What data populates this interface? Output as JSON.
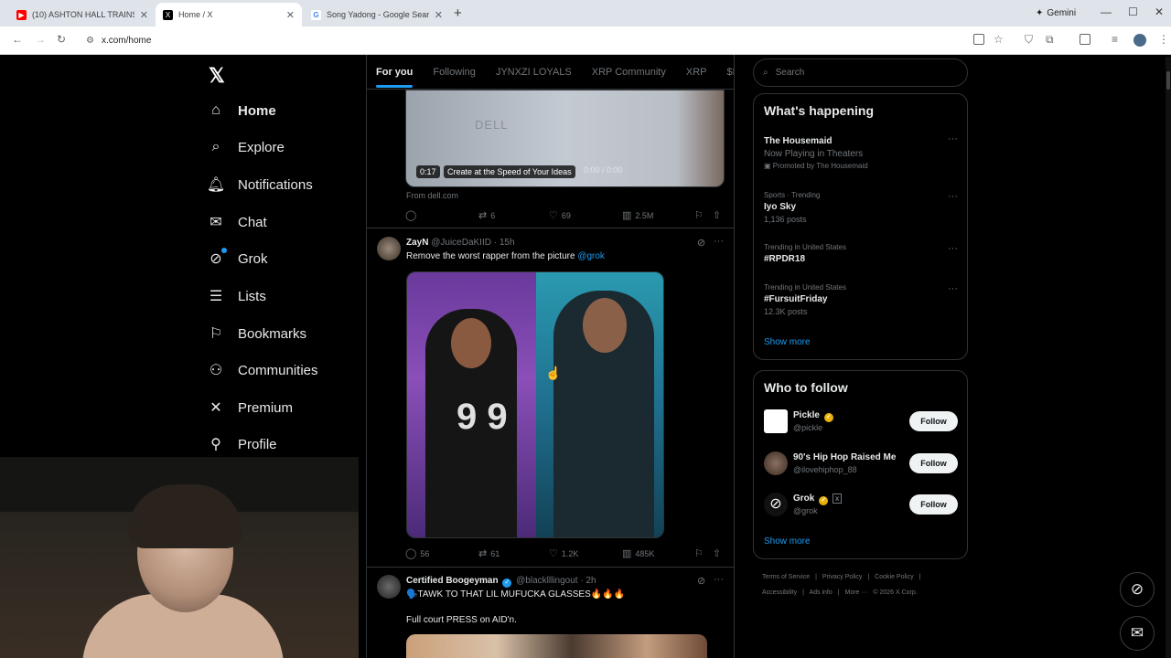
{
  "browser": {
    "tabs": [
      {
        "title": "(10) ASHTON HALL TRAINS AT",
        "favicon": "youtube-icon"
      },
      {
        "title": "Home / X",
        "favicon": "x-icon"
      },
      {
        "title": "Song Yadong - Google Search",
        "favicon": "google-icon"
      }
    ],
    "new_tab": "+",
    "gemini_label": "Gemini",
    "url": "x.com/home"
  },
  "nav": {
    "logo": "𝕏",
    "items": [
      {
        "label": "Home",
        "icon": "home-icon"
      },
      {
        "label": "Explore",
        "icon": "search-icon"
      },
      {
        "label": "Notifications",
        "icon": "bell-icon"
      },
      {
        "label": "Chat",
        "icon": "mail-icon"
      },
      {
        "label": "Grok",
        "icon": "grok-icon"
      },
      {
        "label": "Lists",
        "icon": "list-icon"
      },
      {
        "label": "Bookmarks",
        "icon": "bookmark-icon"
      },
      {
        "label": "Communities",
        "icon": "people-icon"
      },
      {
        "label": "Premium",
        "icon": "x-icon"
      },
      {
        "label": "Profile",
        "icon": "person-icon"
      }
    ]
  },
  "feed": {
    "tabs": [
      "For you",
      "Following",
      "JYNXZI LOYALS",
      "XRP Community",
      "XRP",
      "$PENG"
    ],
    "ad": {
      "brand_text": "DELL",
      "video_time": "0:17",
      "video_caption": "Create at the Speed of Your Ideas",
      "video_progress": "0:00 / 0:00",
      "from": "From dell.com",
      "stats": {
        "reposts": "6",
        "likes": "69",
        "views": "2.5M"
      }
    },
    "posts": [
      {
        "name": "ZayN",
        "handle": "@JuiceDaKIID · 15h",
        "text": "Remove the worst rapper from the picture",
        "mention": "@grok",
        "shirt_number": "9 9",
        "stats": {
          "replies": "56",
          "reposts": "61",
          "likes": "1.2K",
          "views": "485K"
        }
      },
      {
        "name": "Certified Boogeyman",
        "handle": "@blacklllingout · 2h",
        "text_line1": "🗣️TAWK TO THAT LIL MUFUCKA GLASSES🔥🔥🔥",
        "text_line2": "Full court PRESS on AID'n."
      }
    ]
  },
  "sidebar": {
    "search_placeholder": "Search",
    "happening": {
      "title": "What's happening",
      "trends": [
        {
          "meta": "",
          "name": "The Housemaid",
          "sub": "Now Playing in Theaters",
          "sub2": "Promoted by The Housemaid"
        },
        {
          "meta": "Sports · Trending",
          "name": "Iyo Sky",
          "sub": "1,136 posts",
          "sub2": ""
        },
        {
          "meta": "Trending in United States",
          "name": "#RPDR18",
          "sub": "",
          "sub2": ""
        },
        {
          "meta": "Trending in United States",
          "name": "#FursuitFriday",
          "sub": "12.3K posts",
          "sub2": ""
        }
      ],
      "show_more": "Show more"
    },
    "who_to_follow": {
      "title": "Who to follow",
      "accounts": [
        {
          "name": "Pickle",
          "handle": "@pickle",
          "verified": true
        },
        {
          "name": "90's Hip Hop Raised Me",
          "handle": "@ilovehiphop_88",
          "verified": false
        },
        {
          "name": "Grok",
          "handle": "@grok",
          "verified": true
        }
      ],
      "follow_label": "Follow",
      "show_more": "Show more"
    },
    "footer": {
      "line1": [
        "Terms of Service",
        "|",
        "Privacy Policy",
        "|",
        "Cookie Policy",
        "|"
      ],
      "line2": [
        "Accessibility",
        "|",
        "Ads info",
        "|",
        "More ···",
        "© 2026 X Corp."
      ]
    }
  },
  "colors": {
    "accent": "#1d9bf0",
    "background": "#000000",
    "border": "#2f3336",
    "muted": "#71767b"
  }
}
